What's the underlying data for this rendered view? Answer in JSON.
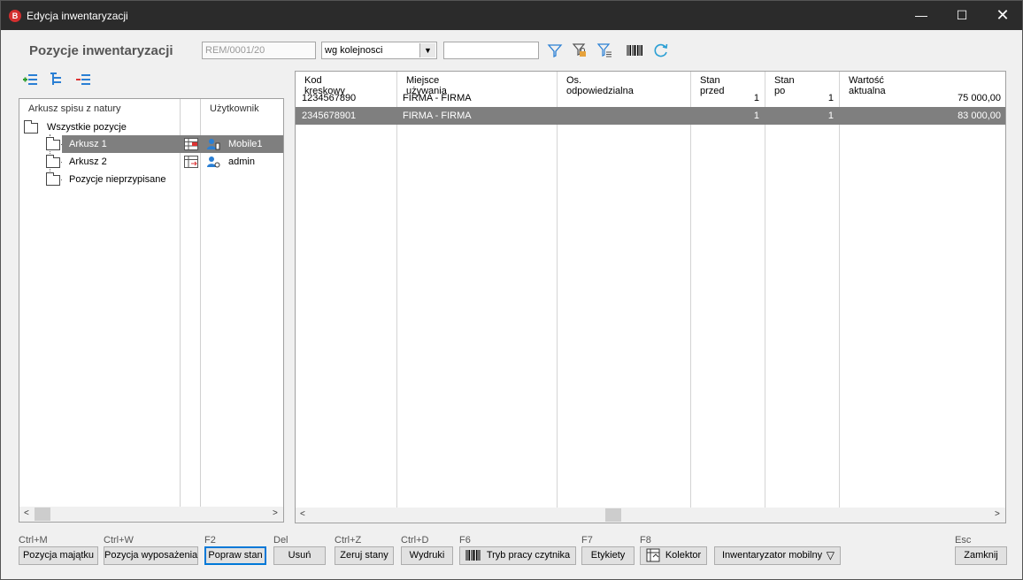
{
  "window": {
    "title": "Edycja inwentaryzacji",
    "min": "—",
    "max": "☐",
    "close": "✕"
  },
  "header": {
    "title": "Pozycje inwentaryzacji",
    "document_number": "REM/0001/20",
    "order_value": "wg kolejnosci",
    "search_value": ""
  },
  "tree": {
    "col1": "Arkusz spisu z natury",
    "col2": "Użytkownik",
    "rows": [
      {
        "label": "Wszystkie pozycje",
        "user": ""
      },
      {
        "label": "Arkusz 1",
        "user": "Mobile1",
        "selected": true
      },
      {
        "label": "Arkusz 2",
        "user": "admin"
      },
      {
        "label": "Pozycje nieprzypisane",
        "user": ""
      }
    ]
  },
  "grid": {
    "columns": [
      "Kod kreskowy",
      "Miejsce używania",
      "Os. odpowiedzialna",
      "Stan przed",
      "Stan po",
      "Wartość aktualna"
    ],
    "rows": [
      {
        "barcode": "1234567890",
        "place": "FIRMA - FIRMA",
        "person": "",
        "before": "1",
        "after": "1",
        "value": "75 000,00"
      },
      {
        "barcode": "2345678901",
        "place": "FIRMA - FIRMA",
        "person": "",
        "before": "1",
        "after": "1",
        "value": "83 000,00",
        "selected": true
      }
    ]
  },
  "buttons": {
    "b1": {
      "shortcut": "Ctrl+M",
      "label": "Pozycja majątku"
    },
    "b2": {
      "shortcut": "Ctrl+W",
      "label": "Pozycja wyposażenia"
    },
    "b3": {
      "shortcut": "F2",
      "label": "Popraw stan"
    },
    "b4": {
      "shortcut": "Del",
      "label": "Usuń"
    },
    "b5": {
      "shortcut": "Ctrl+Z",
      "label": "Zeruj stany"
    },
    "b6": {
      "shortcut": "Ctrl+D",
      "label": "Wydruki"
    },
    "b7": {
      "shortcut": "F6",
      "label": "Tryb pracy czytnika"
    },
    "b8": {
      "shortcut": "F7",
      "label": "Etykiety"
    },
    "b9": {
      "shortcut": "F8",
      "label": "Kolektor"
    },
    "b10": {
      "label": "Inwentaryzator mobilny"
    },
    "b11": {
      "shortcut": "Esc",
      "label": "Zamknij"
    }
  }
}
